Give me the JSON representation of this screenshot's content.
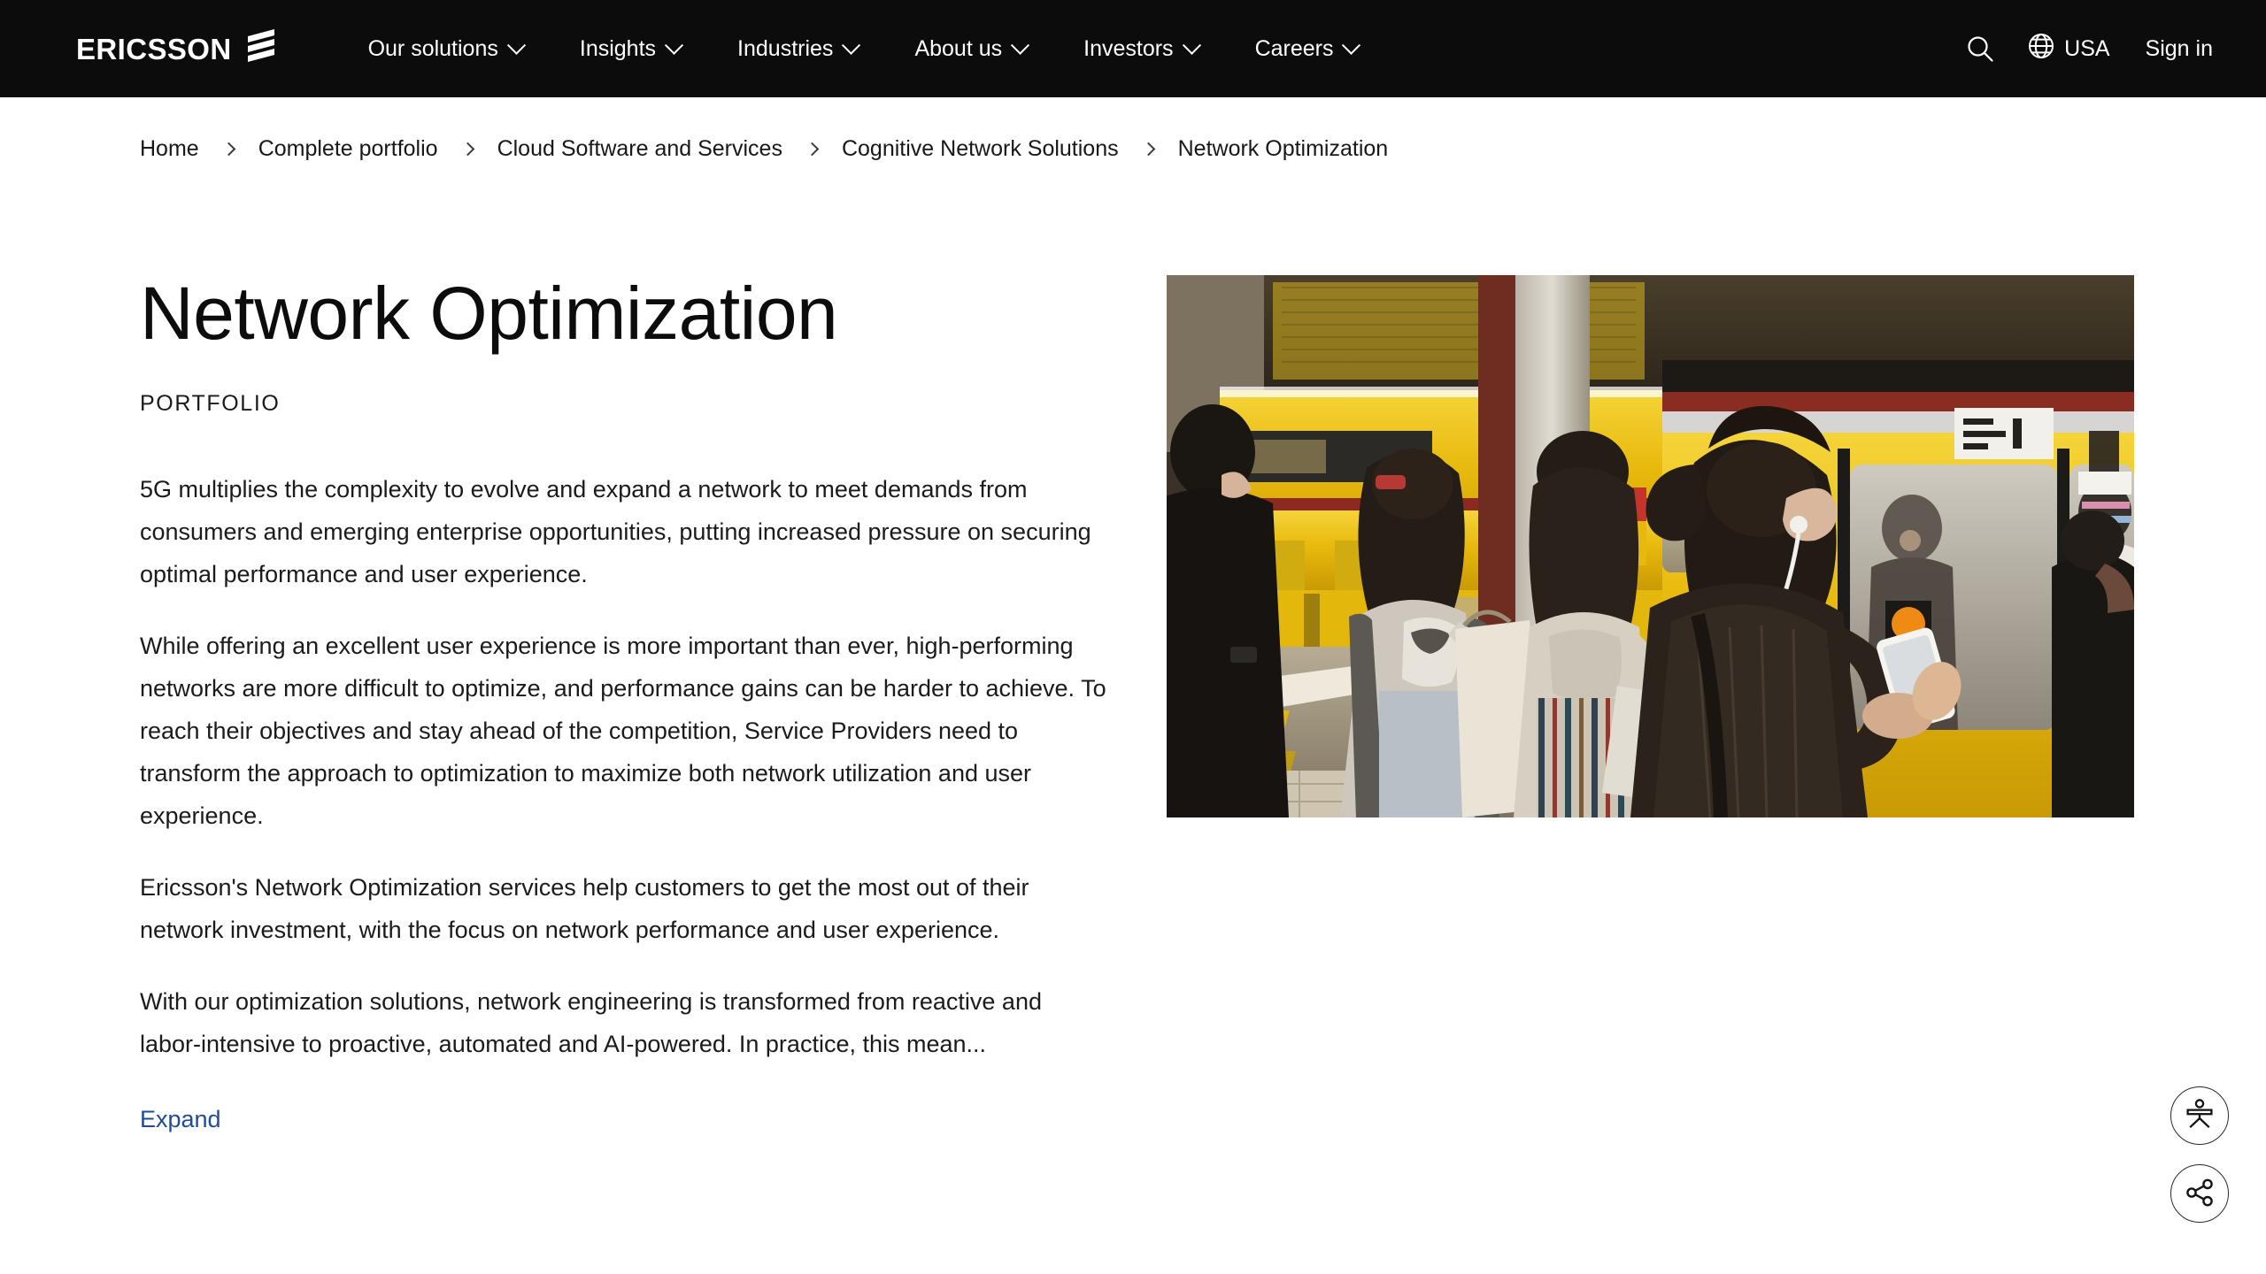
{
  "header": {
    "logo": {
      "wordmark": "ERICSSON",
      "mark_icon": "ericsson-three-bars-icon"
    },
    "nav": [
      {
        "label": "Our solutions",
        "has_dropdown": true
      },
      {
        "label": "Insights",
        "has_dropdown": true
      },
      {
        "label": "Industries",
        "has_dropdown": true
      },
      {
        "label": "About us",
        "has_dropdown": true
      },
      {
        "label": "Investors",
        "has_dropdown": true
      },
      {
        "label": "Careers",
        "has_dropdown": true
      }
    ],
    "search_icon": "search-icon",
    "region": {
      "icon": "globe-icon",
      "label": "USA"
    },
    "sign_in": "Sign in",
    "background_color": "#0c0c0c",
    "text_color": "#ffffff"
  },
  "breadcrumb": [
    {
      "label": "Home"
    },
    {
      "label": "Complete portfolio"
    },
    {
      "label": "Cloud Software and Services"
    },
    {
      "label": "Cognitive Network Solutions"
    },
    {
      "label": "Network Optimization"
    }
  ],
  "main": {
    "title": "Network Optimization",
    "eyebrow": "PORTFOLIO",
    "paragraphs": [
      "5G multiplies the complexity to evolve and expand a network to meet demands from consumers and emerging enterprise opportunities, putting increased pressure on securing optimal performance and user experience.",
      "While offering an excellent user experience is more important than ever, high-performing networks are more difficult to optimize, and performance gains can be harder to achieve. To reach their objectives and stay ahead of the competition, Service Providers need to transform the approach to optimization to maximize both network utilization and user experience.",
      "Ericsson's Network Optimization services help customers to get the most out of their network investment, with the focus on network performance and user experience.",
      "With our optimization solutions, network engineering is transformed from reactive and labor-intensive to proactive, automated and AI-powered. In practice, this mean..."
    ],
    "expand_label": "Expand",
    "expand_color": "#1f4b9b",
    "hero_image": {
      "alt": "Commuters on a subway platform using mobile phones beside a yellow train",
      "dominant_color": "#e8b90c"
    }
  },
  "floating_actions": [
    {
      "icon": "accessibility-person-icon",
      "label": "Accessibility"
    },
    {
      "icon": "share-icon",
      "label": "Share"
    }
  ]
}
